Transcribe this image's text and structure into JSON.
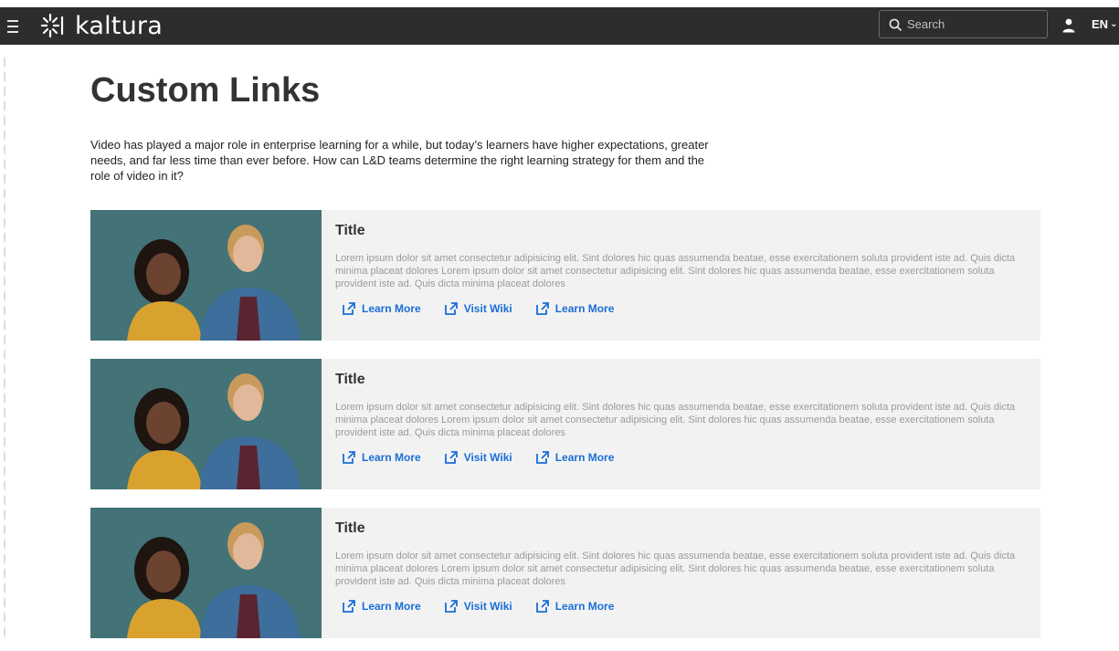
{
  "header": {
    "logo_text": "kaltura",
    "search_placeholder": "Search",
    "language": "EN",
    "icons": {
      "menu": "hamburger-icon",
      "logo": "kaltura-logo-icon",
      "search": "search-icon",
      "user": "user-icon",
      "chevron": "chevron-down-icon"
    }
  },
  "page": {
    "title": "Custom Links",
    "intro": "Video has played a major role in enterprise learning for a while, but today’s learners have higher expectations, greater needs, and far less time than ever before. How can L&D teams determine the right learning strategy for them and the role of video in it?"
  },
  "cards": [
    {
      "title": "Title",
      "text": "Lorem ipsum dolor sit amet consectetur adipisicing elit. Sint dolores hic quas assumenda beatae, esse exercitationem soluta provident iste ad. Quis dicta minima placeat dolores Lorem ipsum dolor sit amet consectetur adipisicing elit. Sint dolores hic quas assumenda beatae, esse exercitationem soluta provident iste ad. Quis dicta minima placeat dolores",
      "links": [
        "Learn More",
        "Visit Wiki",
        "Learn More"
      ]
    },
    {
      "title": "Title",
      "text": "Lorem ipsum dolor sit amet consectetur adipisicing elit. Sint dolores hic quas assumenda beatae, esse exercitationem soluta provident iste ad. Quis dicta minima placeat dolores Lorem ipsum dolor sit amet consectetur adipisicing elit. Sint dolores hic quas assumenda beatae, esse exercitationem soluta provident iste ad. Quis dicta minima placeat dolores",
      "links": [
        "Learn More",
        "Visit Wiki",
        "Learn More"
      ]
    },
    {
      "title": "Title",
      "text": "Lorem ipsum dolor sit amet consectetur adipisicing elit. Sint dolores hic quas assumenda beatae, esse exercitationem soluta provident iste ad. Quis dicta minima placeat dolores Lorem ipsum dolor sit amet consectetur adipisicing elit. Sint dolores hic quas assumenda beatae, esse exercitationem soluta provident iste ad. Quis dicta minima placeat dolores",
      "links": [
        "Learn More",
        "Visit Wiki",
        "Learn More"
      ]
    }
  ],
  "colors": {
    "header_bg": "#2d2d2d",
    "link": "#1a6ed8",
    "card_bg": "#f2f2f2",
    "thumb_bg": "#3f6d72"
  }
}
